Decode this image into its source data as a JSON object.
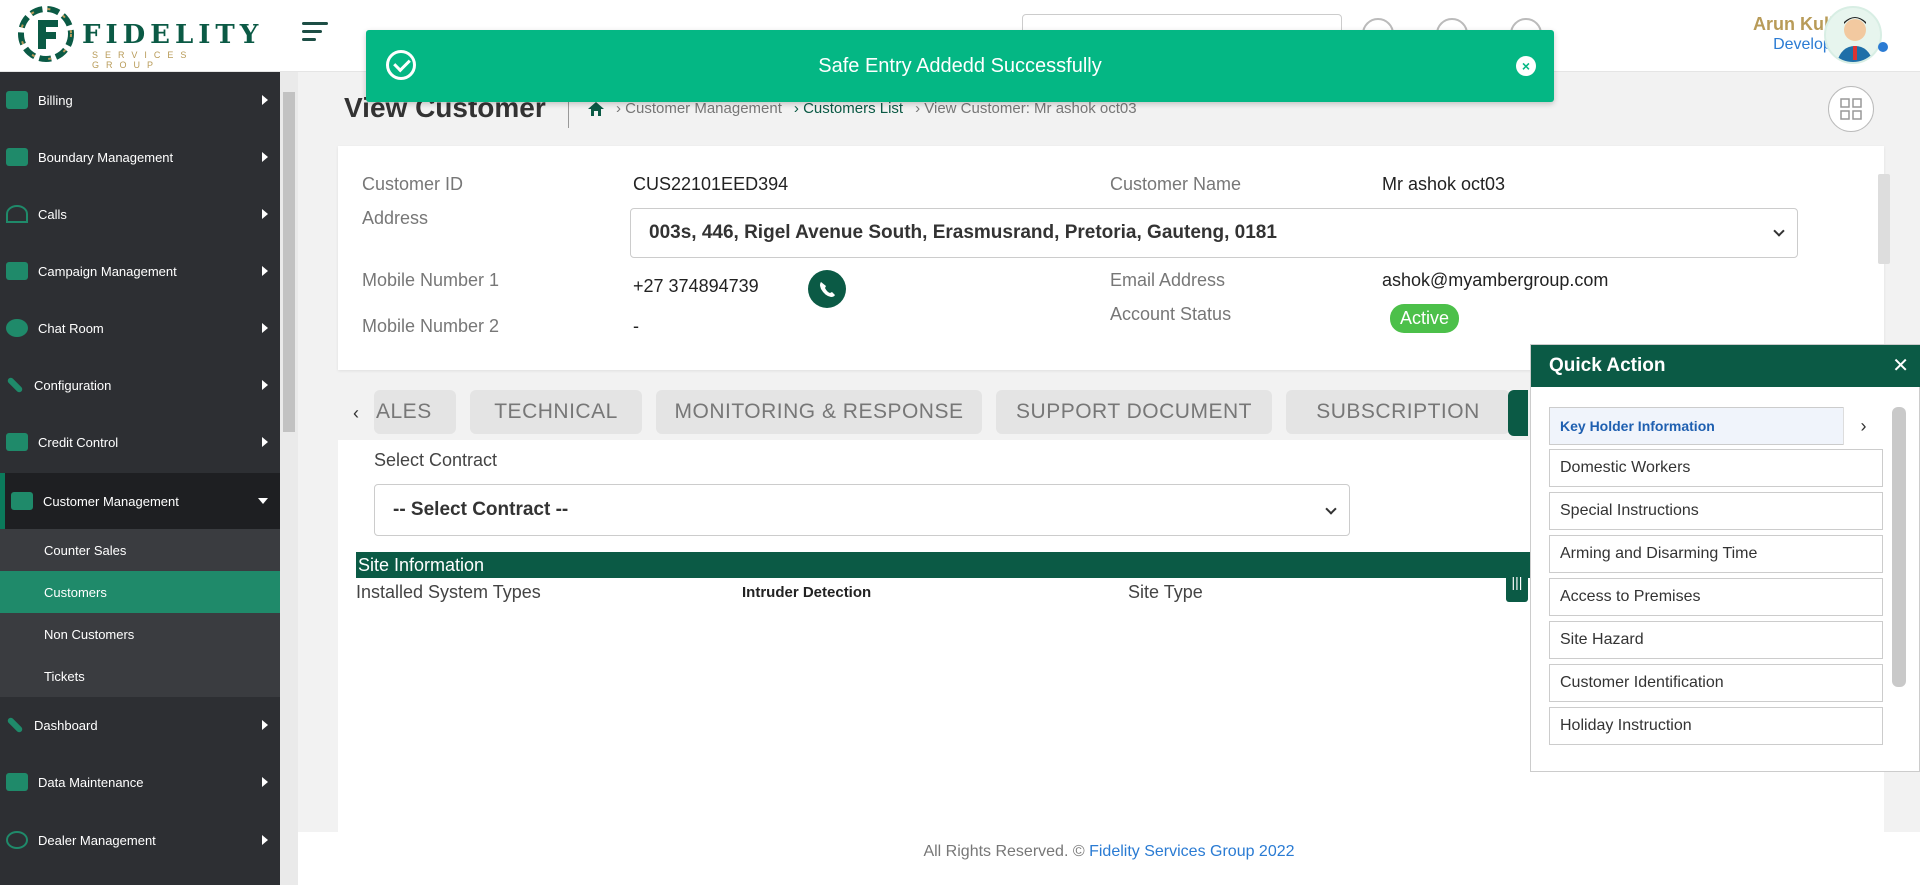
{
  "header": {
    "logo_text": "FIDELITY",
    "logo_sub": "SERVICES GROUP",
    "user_name": "Arun Kulk...",
    "user_role": "Developers"
  },
  "sidebar": {
    "items": [
      {
        "label": "Billing"
      },
      {
        "label": "Boundary Management"
      },
      {
        "label": "Calls"
      },
      {
        "label": "Campaign Management"
      },
      {
        "label": "Chat Room"
      },
      {
        "label": "Configuration"
      },
      {
        "label": "Credit Control"
      },
      {
        "label": "Customer Management"
      },
      {
        "label": "Dashboard"
      },
      {
        "label": "Data Maintenance"
      },
      {
        "label": "Dealer Management"
      }
    ],
    "sub_items": [
      {
        "label": "Counter Sales"
      },
      {
        "label": "Customers"
      },
      {
        "label": "Non Customers"
      },
      {
        "label": "Tickets"
      }
    ]
  },
  "toast": {
    "message": "Safe Entry Addedd Successfully"
  },
  "page": {
    "title": "View Customer",
    "breadcrumb": [
      "› Customer Management",
      "› Customers List",
      "› View Customer: Mr ashok oct03"
    ]
  },
  "customer": {
    "id_label": "Customer ID",
    "id_value": "CUS22101EED394",
    "name_label": "Customer Name",
    "name_value": "Mr ashok oct03",
    "address_label": "Address",
    "address_value": "003s, 446, Rigel Avenue South, Erasmusrand, Pretoria, Gauteng, 0181",
    "mobile1_label": "Mobile Number 1",
    "mobile1_value": "+27 374894739",
    "mobile2_label": "Mobile Number 2",
    "mobile2_value": "-",
    "email_label": "Email Address",
    "email_value": "ashok@myambergroup.com",
    "status_label": "Account Status",
    "status_value": "Active"
  },
  "tabs": [
    {
      "label": "ALES"
    },
    {
      "label": "TECHNICAL"
    },
    {
      "label": "MONITORING & RESPONSE"
    },
    {
      "label": "SUPPORT DOCUMENT"
    },
    {
      "label": "SUBSCRIPTION"
    }
  ],
  "contract": {
    "label": "Select Contract",
    "selected": "-- Select Contract --"
  },
  "site": {
    "bar_title": "Site Information",
    "installed_label": "Installed System Types",
    "installed_value": "Intruder Detection",
    "site_type_label": "Site Type"
  },
  "quick_action": {
    "title": "Quick Action",
    "items": [
      {
        "label": "Key Holder Information"
      },
      {
        "label": "Domestic Workers"
      },
      {
        "label": "Special Instructions"
      },
      {
        "label": "Arming and Disarming Time"
      },
      {
        "label": "Access to Premises"
      },
      {
        "label": "Site Hazard"
      },
      {
        "label": "Customer Identification"
      },
      {
        "label": "Holiday Instruction"
      }
    ]
  },
  "footer": {
    "text": "All Rights Reserved. ©",
    "brand": "Fidelity Services Group 2022"
  },
  "colors": {
    "brand_green": "#0b5a45",
    "toast_green": "#04b784",
    "gold": "#b89b58",
    "active_badge": "#4cc04a"
  }
}
